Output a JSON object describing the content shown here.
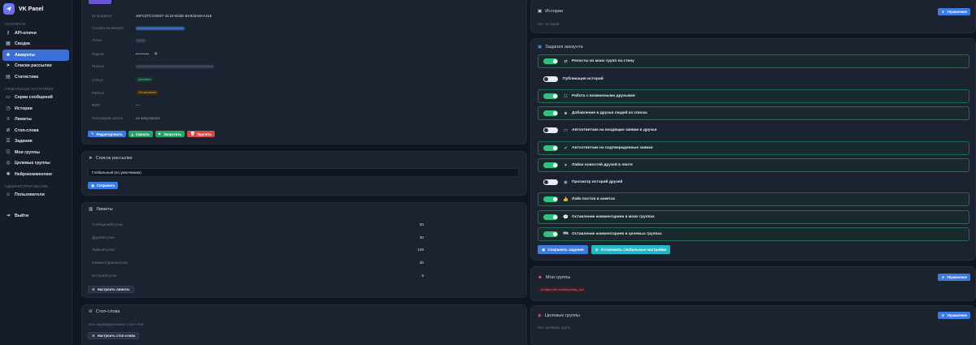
{
  "brand": {
    "title": "VK Panel"
  },
  "sidebar": {
    "sections": [
      {
        "label": "Основное",
        "items": [
          {
            "label": "API-ключи",
            "icon": "key-icon"
          },
          {
            "label": "Сводка",
            "icon": "dashboard-icon"
          },
          {
            "label": "Аккаунты",
            "icon": "users-icon",
            "active": true
          },
          {
            "label": "Списки рассылки",
            "icon": "send-icon"
          },
          {
            "label": "Статистика",
            "icon": "chart-icon"
          }
        ]
      },
      {
        "label": "Глобальные настройки",
        "items": [
          {
            "label": "Серии сообщений",
            "icon": "messages-icon"
          },
          {
            "label": "Истории",
            "icon": "history-icon"
          },
          {
            "label": "Лимиты",
            "icon": "limits-icon"
          },
          {
            "label": "Стоп-слова",
            "icon": "stop-icon"
          },
          {
            "label": "Задания",
            "icon": "tasks-icon"
          },
          {
            "label": "Мои группы",
            "icon": "groups-icon"
          },
          {
            "label": "Целевые группы",
            "icon": "target-icon"
          },
          {
            "label": "Нейрокомментинг",
            "icon": "neuro-icon"
          }
        ]
      },
      {
        "label": "Администрирование",
        "items": [
          {
            "label": "Пользователи",
            "icon": "user-admin-icon"
          }
        ]
      }
    ],
    "logout": "Выйти"
  },
  "profile": {
    "rows": [
      {
        "label": "ID профиля",
        "value": "46FC07C3-D037-4C1E-B32E-BA933A8AA419"
      },
      {
        "label": "Ссылка на аккаунт",
        "value": ""
      },
      {
        "label": "Логин",
        "value": ""
      },
      {
        "label": "Пароль",
        "value": "••••••••"
      },
      {
        "label": "Прокси",
        "value": ""
      },
      {
        "label": "Статус",
        "value": "Активен"
      },
      {
        "label": "Работа",
        "value": "Остановлен"
      },
      {
        "label": "ФИО",
        "value": "—"
      },
      {
        "label": "Последний запуск",
        "value": "не запускался"
      }
    ],
    "buttons": {
      "edit": "Редактировать",
      "download": "Скачать",
      "start": "Запустить",
      "delete": "Удалить"
    }
  },
  "mailing": {
    "title": "Список рассылки",
    "selected": "Глобальный (по умолчанию)",
    "save": "Сохранить"
  },
  "limits": {
    "title": "Лимиты",
    "rows": [
      {
        "label": "Сообщений/сутки",
        "value": "50"
      },
      {
        "label": "Друзей/сутки",
        "value": "30"
      },
      {
        "label": "Лайков/сутки",
        "value": "100"
      },
      {
        "label": "Комментариев/сутки",
        "value": "30"
      },
      {
        "label": "Историй/сутки",
        "value": "5"
      }
    ],
    "button": "Настроить лимиты"
  },
  "stopwords": {
    "title": "Стоп-слова",
    "empty": "Нет индивидуальных стоп-слов",
    "button": "Настроить стоп-слова"
  },
  "stories": {
    "title": "Истории",
    "empty": "Нет историй",
    "manage": "Управление"
  },
  "tasks": {
    "title": "Задания аккаунта",
    "items": [
      {
        "label": "Репосты из моих групп на стену",
        "on": true,
        "icon": "repost-icon"
      },
      {
        "label": "Публикация историй",
        "on": false,
        "icon": ""
      },
      {
        "label": "Работа с возможными друзьями",
        "on": true,
        "icon": "friends-icon"
      },
      {
        "label": "Добавление в друзья людей из списка",
        "on": true,
        "icon": "user-add-icon"
      },
      {
        "label": "Автоответчик на входящие заявки в друзья",
        "on": false,
        "icon": "inbox-icon"
      },
      {
        "label": "Автоответчик на подтвержденные заявки",
        "on": true,
        "icon": "check-circle-icon"
      },
      {
        "label": "Лайки новостей друзей в ленте",
        "on": true,
        "icon": "heart-icon"
      },
      {
        "label": "Просмотр историй друзей",
        "on": false,
        "icon": "eye-icon"
      },
      {
        "label": "Лайк постов в анкетах",
        "on": true,
        "icon": "thumb-up-icon"
      },
      {
        "label": "Оставление комментариев в моих группах",
        "on": true,
        "icon": "comment-icon"
      },
      {
        "label": "Оставление комментариев в целевых группах",
        "on": true,
        "icon": "comments-icon"
      }
    ],
    "save": "Сохранить задания",
    "global": "Установить глобальные настройки"
  },
  "mygroups": {
    "title": "Мои группы",
    "link": "https://vk.com/kmpnsky_bot",
    "manage": "Управление"
  },
  "targetgroups": {
    "title": "Целевые группы",
    "empty": "Нет целевых групп",
    "manage": "Управление"
  },
  "colors": {
    "accent": "#3b7be0",
    "success": "#2ec27e",
    "danger": "#d94848",
    "background": "#10161f",
    "card": "#1b2330"
  }
}
